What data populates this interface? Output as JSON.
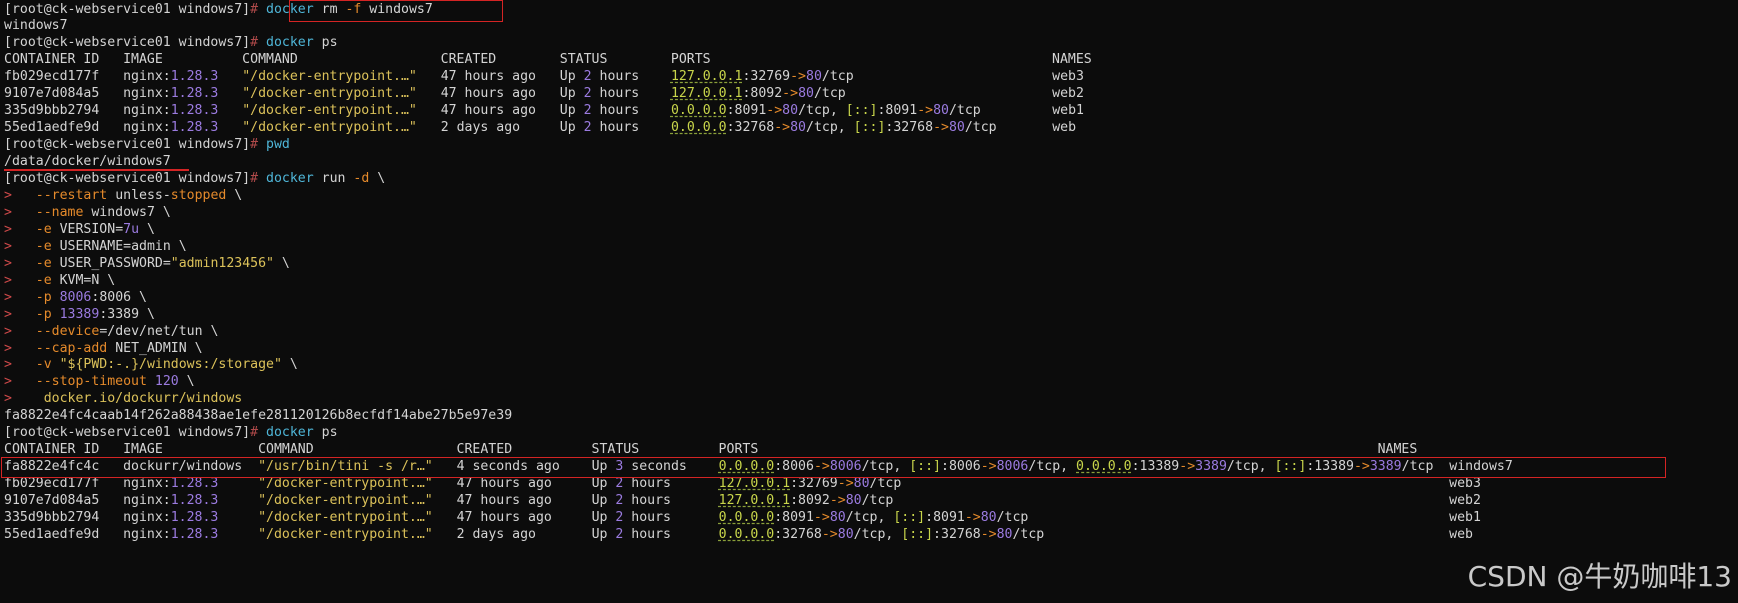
{
  "prompt": "[root@ck-webservice01 windows7]",
  "hash": "#",
  "cmd1": {
    "docker": "docker",
    "rest": " rm ",
    "flag": "-f",
    "arg": " windows7"
  },
  "out1": "windows7",
  "cmd2": {
    "docker": "docker",
    "rest": " ps"
  },
  "ps1_header": "CONTAINER ID   IMAGE          COMMAND                  CREATED        STATUS        PORTS                                           NAMES",
  "ps1_rows": [
    {
      "id": "fb029ecd177f",
      "img": "nginx:",
      "ver": "1.28.3",
      "cmd": "\"/docker-entrypoint.…\"",
      "created": "47 hours ago",
      "up": "Up ",
      "upn": "2",
      "upu": " hours",
      "ports": "127.0.0.1:32769->80/tcp",
      "name": "web3"
    },
    {
      "id": "9107e7d084a5",
      "img": "nginx:",
      "ver": "1.28.3",
      "cmd": "\"/docker-entrypoint.…\"",
      "created": "47 hours ago",
      "up": "Up ",
      "upn": "2",
      "upu": " hours",
      "ports": "127.0.0.1:8092->80/tcp",
      "name": "web2"
    },
    {
      "id": "335d9bbb2794",
      "img": "nginx:",
      "ver": "1.28.3",
      "cmd": "\"/docker-entrypoint.…\"",
      "created": "47 hours ago",
      "up": "Up ",
      "upn": "2",
      "upu": " hours",
      "ports": "0.0.0.0:8091->80/tcp, [::]:8091->80/tcp",
      "name": "web1"
    },
    {
      "id": "55ed1aedfe9d",
      "img": "nginx:",
      "ver": "1.28.3",
      "cmd": "\"/docker-entrypoint.…\"",
      "created": "2 days ago",
      "up": "Up ",
      "upn": "2",
      "upu": " hours",
      "ports": "0.0.0.0:32768->80/tcp, [::]:32768->80/tcp",
      "name": "web"
    }
  ],
  "cmd3": "pwd",
  "out3": "/data/docker/windows7",
  "cmd4": {
    "docker": "docker",
    "rest": " run ",
    "flag": "-d",
    "tail": " \\"
  },
  "run_lines": [
    {
      "p": ">",
      "flag": "--restart",
      "rest": " unless-",
      "flag2": "stopped",
      "tail": " \\"
    },
    {
      "p": ">",
      "flag": "--name",
      "rest": " windows7 \\"
    },
    {
      "p": ">",
      "flag": "-e",
      "rest": " VERSION=",
      "num": "7u",
      "tail": " \\"
    },
    {
      "p": ">",
      "flag": "-e",
      "rest": " USERNAME=admin \\"
    },
    {
      "p": ">",
      "flag": "-e",
      "rest": " USER_PASSWORD=",
      "str": "\"admin123456\"",
      "tail": " \\"
    },
    {
      "p": ">",
      "flag": "-e",
      "rest": " KVM=N \\"
    },
    {
      "p": ">",
      "flag": "-p",
      "num": " 8006",
      "rest": ":8006 \\"
    },
    {
      "p": ">",
      "flag": "-p",
      "num": " 13389",
      "rest": ":3389 \\"
    },
    {
      "p": ">",
      "flag": "--device",
      "rest": "=/dev/net/tun \\"
    },
    {
      "p": ">",
      "flag": "--cap-add",
      "rest": " NET_ADMIN \\"
    },
    {
      "p": ">",
      "flag": "-v",
      "str": " \"${PWD:-.}/windows:/storage\"",
      "tail": " \\"
    },
    {
      "p": ">",
      "flag": "--stop-timeout",
      "num": " 120",
      "tail": " \\"
    },
    {
      "p": ">",
      "str": " docker.io/dockurr/windows"
    }
  ],
  "out4": "fa8822e4fc4caab14f262a88438ae1efe281120126b8ecfdf14abe27b5e97e39",
  "cmd5": {
    "docker": "docker",
    "rest": " ps"
  },
  "ps2_header": "CONTAINER ID   IMAGE            COMMAND                  CREATED          STATUS          PORTS",
  "ps2_header_names": "NAMES",
  "ps2_rows": [
    {
      "id": "fa8822e4fc4c",
      "img": "dockurr/windows",
      "ver": "",
      "cmd": "\"/usr/bin/tini -s /r…\"",
      "created": "4 seconds ago",
      "up": "Up ",
      "upn": "3",
      "upu": " seconds",
      "ports": "0.0.0.0:8006->8006/tcp, [::]:8006->8006/tcp, 0.0.0.0:13389->3389/tcp, [::]:13389->3389/tcp",
      "name": "windows7"
    },
    {
      "id": "fb029ecd177f",
      "img": "nginx:",
      "ver": "1.28.3",
      "cmd": "\"/docker-entrypoint.…\"",
      "created": "47 hours ago",
      "up": "Up ",
      "upn": "2",
      "upu": " hours",
      "ports": "127.0.0.1:32769->80/tcp",
      "name": "web3"
    },
    {
      "id": "9107e7d084a5",
      "img": "nginx:",
      "ver": "1.28.3",
      "cmd": "\"/docker-entrypoint.…\"",
      "created": "47 hours ago",
      "up": "Up ",
      "upn": "2",
      "upu": " hours",
      "ports": "127.0.0.1:8092->80/tcp",
      "name": "web2"
    },
    {
      "id": "335d9bbb2794",
      "img": "nginx:",
      "ver": "1.28.3",
      "cmd": "\"/docker-entrypoint.…\"",
      "created": "47 hours ago",
      "up": "Up ",
      "upn": "2",
      "upu": " hours",
      "ports": "0.0.0.0:8091->80/tcp, [::]:8091->80/tcp",
      "name": "web1"
    },
    {
      "id": "55ed1aedfe9d",
      "img": "nginx:",
      "ver": "1.28.3",
      "cmd": "\"/docker-entrypoint.…\"",
      "created": "2 days ago",
      "up": "Up ",
      "upn": "2",
      "upu": " hours",
      "ports": "0.0.0.0:32768->80/tcp, [::]:32768->80/tcp",
      "name": "web"
    }
  ],
  "watermark": "CSDN @牛奶咖啡13",
  "colors": {
    "background": "#0c0c0c",
    "text": "#d4d4d4",
    "command": "#4fb6d8",
    "flag": "#e58a2b",
    "number": "#9b7be0",
    "string": "#dcc25a",
    "ip": "#c9d64b",
    "highlight": "#d42424"
  }
}
